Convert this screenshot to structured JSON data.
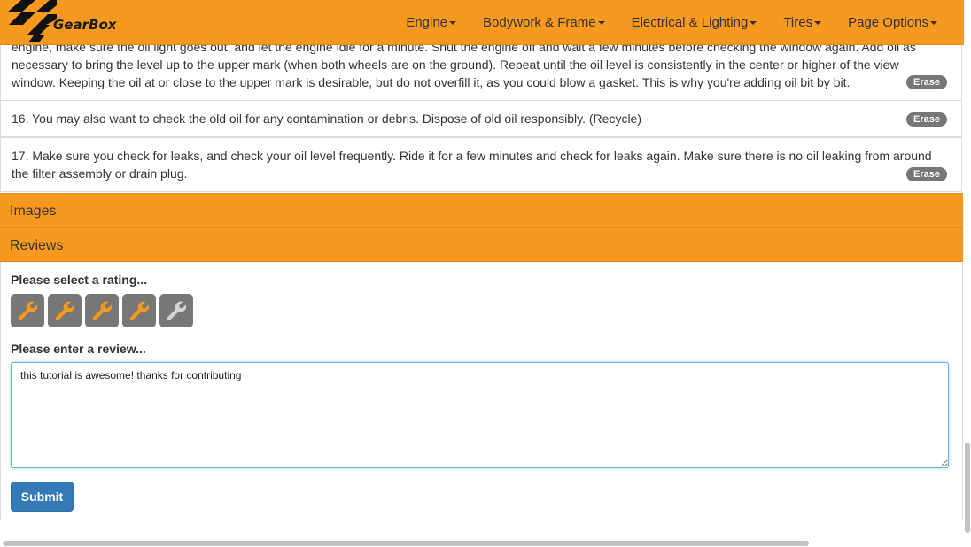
{
  "brand": {
    "name": "GearBox"
  },
  "nav": {
    "items": [
      "Engine",
      "Bodywork & Frame",
      "Electrical & Lighting",
      "Tires",
      "Page Options"
    ]
  },
  "steps": [
    {
      "line1": "engine, make sure the oil light goes out, and let the engine idle for a minute. Shut the engine off and wait a few minutes before checking the window again. Add oil as",
      "line2": "necessary to bring the level up to the upper mark (when both wheels are on the ground). Repeat until the oil level is consistently in the center or higher of the view",
      "line3": "window. Keeping the oil at or close to the upper mark is desirable, but do not overfill it, as you could blow a gasket. This is why you're adding oil bit by bit."
    },
    {
      "line1": "16. You may also want to check the old oil for any contamination or debris. Dispose of old oil responsibly. (Recycle)"
    },
    {
      "line1": "17. Make sure you check for leaks, and check your oil level frequently. Ride it for a few minutes and check for leaks again. Make sure there is no oil leaking from around",
      "line2": "the filter assembly or drain plug."
    }
  ],
  "erase_label": "Erase",
  "sections": {
    "images": "Images",
    "reviews": "Reviews"
  },
  "review_form": {
    "rating_label": "Please select a rating...",
    "rating_value": 4,
    "rating_max": 5,
    "review_label": "Please enter a review...",
    "review_text": "this tutorial is awesome! thanks for contributing",
    "submit_label": "Submit"
  },
  "colors": {
    "brand_orange": "#f7991f",
    "wrench_active": "#f7991f",
    "wrench_inactive": "#d4d4d4",
    "button_primary": "#337ab7",
    "badge_grey": "#777777"
  }
}
